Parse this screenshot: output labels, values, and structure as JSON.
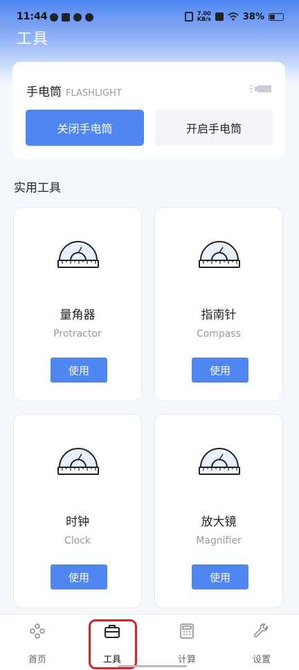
{
  "status_bar": {
    "time": "11:44",
    "net_speed_value": "7.00",
    "net_speed_unit": "KB/s",
    "battery": "38%"
  },
  "page": {
    "title": "工具"
  },
  "flashlight": {
    "title": "手电筒",
    "subtitle": "FLASHLIGHT",
    "off_label": "关闭手电筒",
    "on_label": "开启手电筒"
  },
  "section": {
    "title": "实用工具"
  },
  "tools": [
    {
      "name": "量角器",
      "en": "Protractor",
      "button": "使用"
    },
    {
      "name": "指南针",
      "en": "Compass",
      "button": "使用"
    },
    {
      "name": "时钟",
      "en": "Clock",
      "button": "使用"
    },
    {
      "name": "放大镜",
      "en": "Magnifier",
      "button": "使用"
    }
  ],
  "tabbar": {
    "items": [
      {
        "label": "首页",
        "icon": "home-dots-icon"
      },
      {
        "label": "工具",
        "icon": "toolbox-icon"
      },
      {
        "label": "计算",
        "icon": "calculator-icon"
      },
      {
        "label": "设置",
        "icon": "wrench-icon"
      }
    ],
    "active_index": 1
  },
  "colors": {
    "accent": "#4f86f2",
    "highlight_ring": "#e0221f"
  }
}
